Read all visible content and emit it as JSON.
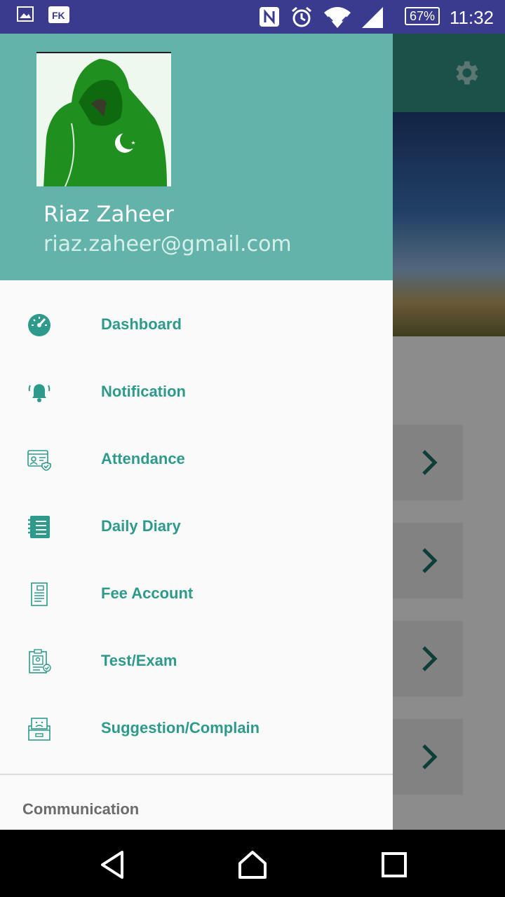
{
  "status_bar": {
    "time": "11:32",
    "battery_percent": "67%",
    "icons": [
      "gallery-icon",
      "fk-app-icon",
      "nfc-icon",
      "alarm-icon",
      "wifi-icon",
      "signal-icon",
      "battery-icon"
    ]
  },
  "drawer": {
    "user": {
      "name": "Riaz Zaheer",
      "email": "riaz.zaheer@gmail.com"
    },
    "menu_items": [
      {
        "label": "Dashboard",
        "icon": "dashboard-gauge-icon"
      },
      {
        "label": "Notification",
        "icon": "bell-icon"
      },
      {
        "label": "Attendance",
        "icon": "attendance-id-card-icon"
      },
      {
        "label": "Daily Diary",
        "icon": "diary-notebook-icon"
      },
      {
        "label": "Fee Account",
        "icon": "fee-document-icon"
      },
      {
        "label": "Test/Exam",
        "icon": "exam-clipboard-icon"
      },
      {
        "label": "Suggestion/Complain",
        "icon": "complaint-box-icon"
      }
    ],
    "section_title": "Communication"
  },
  "background_app": {
    "settings_icon": "gear-icon",
    "list_chevrons": 4
  },
  "nav_bar": {
    "buttons": [
      "back-icon",
      "home-icon",
      "recents-icon"
    ]
  },
  "colors": {
    "status_bar": "#3a3a8f",
    "drawer_header": "#63b3aa",
    "accent": "#2e9a8c",
    "toolbar": "#2f8c7e"
  }
}
